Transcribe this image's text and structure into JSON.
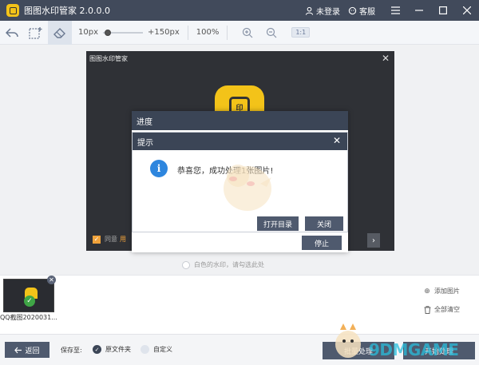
{
  "app": {
    "title": "图图水印管家 2.0.0.0",
    "login": "未登录",
    "service": "客服"
  },
  "toolbar": {
    "size_min": "10px",
    "size_max": "+150px",
    "zoom": "100%",
    "ratio": "1:1",
    "slider_level_percent": 5
  },
  "editor": {
    "title": "图图水印管家",
    "logo_char": "印",
    "agree_text": "同意",
    "agree_link": "用"
  },
  "progress_dialog": {
    "title": "进度",
    "stop_label": "停止"
  },
  "tip_dialog": {
    "title": "提示",
    "message": "恭喜您，成功处理1张图片!",
    "open_folder_label": "打开目录",
    "close_label": "关闭"
  },
  "watermark_hint": "白色的水印，请勾选此处",
  "files": [
    {
      "name": "QQ截图2020031..."
    }
  ],
  "side_actions": {
    "add_image": "添加图片",
    "clear_all": "全部清空"
  },
  "bottom": {
    "back_label": "返回",
    "save_to": "保存至:",
    "option_original": "原文件夹",
    "option_custom": "自定义",
    "batch_label": "批量处理",
    "start_label": "开始处理"
  },
  "watermark_overlay": "9DMGAME",
  "colors": {
    "titlebar": "#414a5b",
    "accent": "#f3c319",
    "button": "#4f5a6e",
    "success": "#3fa646",
    "info": "#2e86de"
  }
}
